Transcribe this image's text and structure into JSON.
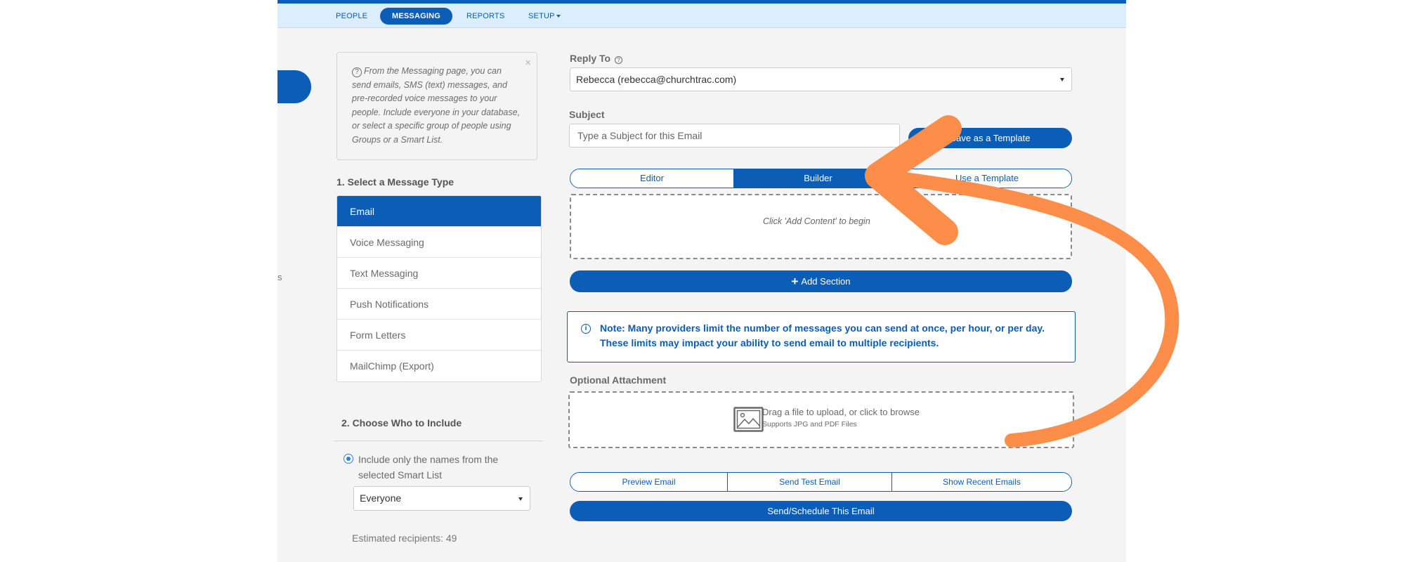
{
  "nav": {
    "items": [
      {
        "label": "PEOPLE"
      },
      {
        "label": "MESSAGING"
      },
      {
        "label": "REPORTS"
      },
      {
        "label": "SETUP"
      }
    ]
  },
  "sidebar": {
    "partial_text": "s"
  },
  "info": {
    "text": "From the Messaging page, you can send emails, SMS (text) messages, and pre-recorded voice messages to your people. Include everyone in your database, or select a specific group of people using Groups or a Smart List.",
    "close": "×"
  },
  "message_type": {
    "heading": "1. Select a Message Type",
    "items": [
      "Email",
      "Voice Messaging",
      "Text Messaging",
      "Push Notifications",
      "Form Letters",
      "MailChimp (Export)"
    ]
  },
  "include": {
    "heading": "2. Choose Who to Include",
    "radio_label": "Include only the names from the selected Smart List",
    "smart_list": "Everyone",
    "estimate": "Estimated recipients: 49"
  },
  "reply_to": {
    "label": "Reply To",
    "value": "Rebecca (rebecca@churchtrac.com)"
  },
  "subject": {
    "label": "Subject",
    "placeholder": "Type a Subject for this Email",
    "save_template": "Save as a Template"
  },
  "editor_tabs": [
    "Editor",
    "Builder",
    "Use a Template"
  ],
  "builder": {
    "hint": "Click 'Add Content' to begin",
    "add_section": "Add Section"
  },
  "note": {
    "icon": "i",
    "text": "Note: Many providers limit the number of messages you can send at once, per hour, or per day. These limits may impact your ability to send email to multiple recipients."
  },
  "attachment": {
    "label": "Optional Attachment",
    "drop_text": "Drag a file to upload, or click to browse",
    "supports": "Supports JPG and PDF Files"
  },
  "actions": [
    "Preview Email",
    "Send Test Email",
    "Show Recent Emails"
  ],
  "send_button": "Send/Schedule This Email",
  "colors": {
    "brand": "#0b5db5",
    "annotation_arrow": "#fc8e49"
  }
}
